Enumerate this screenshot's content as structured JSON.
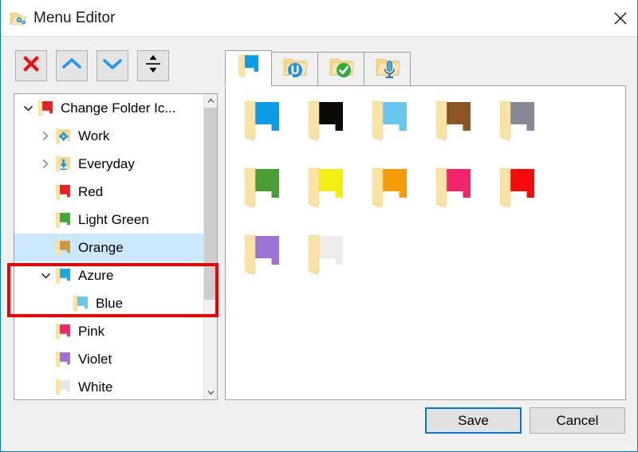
{
  "window": {
    "title": "Menu Editor",
    "title_icon": "folder-gears-icon",
    "close_label": "✕",
    "accent_color": "#0078d7",
    "body_background": "#f0f0f0"
  },
  "toolbar": {
    "buttons": [
      {
        "name": "delete-button",
        "icon": "red-x-icon",
        "color": "#ee1111"
      },
      {
        "name": "move-up-button",
        "icon": "chevron-up-icon",
        "color": "#2196f3"
      },
      {
        "name": "move-down-button",
        "icon": "chevron-down-icon",
        "color": "#2196f3"
      },
      {
        "name": "add-separator-button",
        "icon": "up-down-arrows-icon",
        "color": "#000000"
      }
    ]
  },
  "tree": {
    "items": [
      {
        "label": "Change Folder Ic...",
        "level": 0,
        "expander": "chevron-down",
        "folder_color": "#ee1c25",
        "selected": false
      },
      {
        "label": "Work",
        "level": 1,
        "expander": "chevron-right",
        "folder_color": "#f5d98a",
        "overlay": "gear",
        "selected": false
      },
      {
        "label": "Everyday",
        "level": 1,
        "expander": "chevron-right",
        "folder_color": "#f5d98a",
        "overlay": "download",
        "selected": false
      },
      {
        "label": "Red",
        "level": 1,
        "expander": "none",
        "folder_color": "#ee1c25",
        "selected": false
      },
      {
        "label": "Light Green",
        "level": 1,
        "expander": "none",
        "folder_color": "#3faa35",
        "selected": false
      },
      {
        "label": "Orange",
        "level": 1,
        "expander": "none",
        "folder_color": "#c99b3d",
        "selected": true
      },
      {
        "label": "Azure",
        "level": 1,
        "expander": "chevron-down",
        "folder_color": "#17a9e8",
        "selected": false
      },
      {
        "label": "Blue",
        "level": 2,
        "expander": "none",
        "folder_color": "#68c5ee",
        "selected": false
      },
      {
        "label": "Pink",
        "level": 1,
        "expander": "none",
        "folder_color": "#f2246b",
        "selected": false
      },
      {
        "label": "Violet",
        "level": 1,
        "expander": "none",
        "folder_color": "#9b6fd4",
        "selected": false
      },
      {
        "label": "White",
        "level": 1,
        "expander": "none",
        "folder_color": "#e8e8e8",
        "selected": false
      }
    ],
    "scrollbar": {
      "up_arrow": "∧",
      "down_arrow": "∨",
      "thumb_color": "#cdcdcd"
    },
    "annotation": {
      "name": "red-highlight-rectangle",
      "color": "#ee0000",
      "covers": [
        "Azure",
        "Blue"
      ]
    }
  },
  "tabs": [
    {
      "name": "tab-plain-folders",
      "icon": "blue-folder-icon",
      "active": true
    },
    {
      "name": "tab-utorrent-folders",
      "icon": "folder-utorrent-icon",
      "active": false
    },
    {
      "name": "tab-checked-folders",
      "icon": "folder-check-icon",
      "active": false
    },
    {
      "name": "tab-microphone-folders",
      "icon": "folder-microphone-icon",
      "active": false
    }
  ],
  "icon_grid": {
    "icons": [
      {
        "name": "folder-blue",
        "color": "#0c9ce8"
      },
      {
        "name": "folder-black",
        "color": "#0a0a0a"
      },
      {
        "name": "folder-light-blue",
        "color": "#69c7ef"
      },
      {
        "name": "folder-brown",
        "color": "#8c5523"
      },
      {
        "name": "folder-gray",
        "color": "#878996"
      },
      {
        "name": "folder-green",
        "color": "#4a9e35"
      },
      {
        "name": "folder-yellow",
        "color": "#f4ef12"
      },
      {
        "name": "folder-orange",
        "color": "#f59d08"
      },
      {
        "name": "folder-pink",
        "color": "#f2246b"
      },
      {
        "name": "folder-red",
        "color": "#f40c0c"
      },
      {
        "name": "folder-violet",
        "color": "#9b74d6"
      },
      {
        "name": "folder-white",
        "color": "#ededed"
      }
    ]
  },
  "footer": {
    "save_label": "Save",
    "cancel_label": "Cancel"
  }
}
